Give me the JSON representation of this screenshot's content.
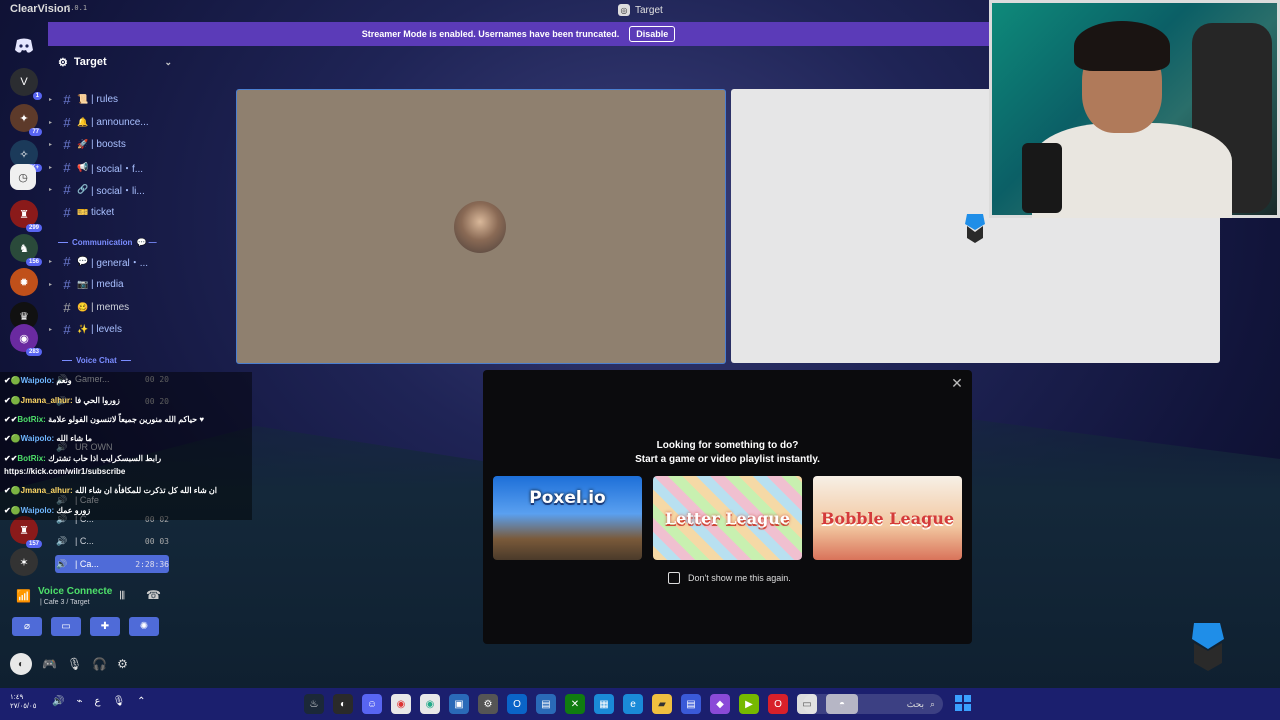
{
  "app": {
    "name": "ClearVision",
    "version": "7.0.1",
    "window_title": "Target"
  },
  "banner": {
    "text": "Streamer Mode is enabled. Usernames have been truncated.",
    "button": "Disable"
  },
  "servers": [
    {
      "icon": "discord-icon"
    },
    {
      "icon": "server-icon",
      "badge": "1"
    },
    {
      "icon": "server-icon",
      "badge": "77"
    },
    {
      "icon": "server-icon",
      "badge": "1K+"
    },
    {
      "icon": "server-icon"
    },
    {
      "icon": "server-icon",
      "badge": "299"
    },
    {
      "icon": "server-icon",
      "badge": "156"
    },
    {
      "icon": "server-icon"
    },
    {
      "icon": "server-icon"
    },
    {
      "icon": "server-icon",
      "badge": "283"
    }
  ],
  "server_name": "Target",
  "channels": [
    {
      "emoji": "📜",
      "name": "| rules"
    },
    {
      "emoji": "🔔",
      "name": "| announce..."
    },
    {
      "emoji": "🚀",
      "name": "| boosts"
    },
    {
      "emoji": "📢",
      "name": "| social・f..."
    },
    {
      "emoji": "🔗",
      "name": "| social・li..."
    },
    {
      "emoji": "🎫",
      "name": "ticket"
    }
  ],
  "category_communication": "Communication",
  "comm_channels": [
    {
      "emoji": "💬",
      "name": "| general・..."
    },
    {
      "emoji": "📷",
      "name": "| media"
    },
    {
      "emoji": "🥴",
      "name": "| memes"
    },
    {
      "emoji": "✨",
      "name": "| levels"
    }
  ],
  "category_voice": "Voice Chat",
  "voice_rows": [
    {
      "name": "Gamer...",
      "count": "00 20"
    },
    {
      "name": "",
      "count": "00 20"
    },
    {
      "name": "UR OWN",
      "count": ""
    },
    {
      "name": "| Cafe",
      "count": ""
    },
    {
      "name": "| C...",
      "count": "00 02"
    },
    {
      "name": "| C...",
      "count": "00 03"
    },
    {
      "name": "| Ca...",
      "count": "2:28:36"
    }
  ],
  "chat": [
    {
      "user": "Waipolo:",
      "text": "وتعم"
    },
    {
      "user": "Jmana_alhur:",
      "text": "زوروا الحي فا"
    },
    {
      "user": "BotRix:",
      "text": "حياكم الله منورين جميعاً لاتنسون الفولو علامة ♥"
    },
    {
      "user": "Waipolo:",
      "text": "ما شاء الله"
    },
    {
      "user": "BotRix:",
      "text": "رابط السبسكرايب اذا حاب تشترك"
    },
    {
      "user": "",
      "text": "https://kick.com/wilr1/subscribe"
    },
    {
      "user": "Jmana_alhur:",
      "text": "ان شاء الله كل تذكرت للمكافأة ان شاء الله"
    },
    {
      "user": "Waipolo:",
      "text": "زورو عمك"
    }
  ],
  "voice_connected": {
    "title": "Voice Connecte",
    "sub": "| Cafe 3 / Target"
  },
  "modal": {
    "title": "Looking for something to do?",
    "subtitle": "Start a game or video playlist instantly.",
    "games": [
      "Poxel.io",
      "Letter League",
      "Bobble League"
    ],
    "checkbox_label": "Don't show me this again."
  },
  "taskbar": {
    "time": "١:٤٩",
    "date": "٢٧/٠٥/٠٥",
    "lang": "ع",
    "search_placeholder": "بحث"
  },
  "colors": {
    "accent": "#5865f2",
    "banner": "#5b3bb8",
    "voice_green": "#4ee06a",
    "taskbar": "#1b1f6e"
  }
}
